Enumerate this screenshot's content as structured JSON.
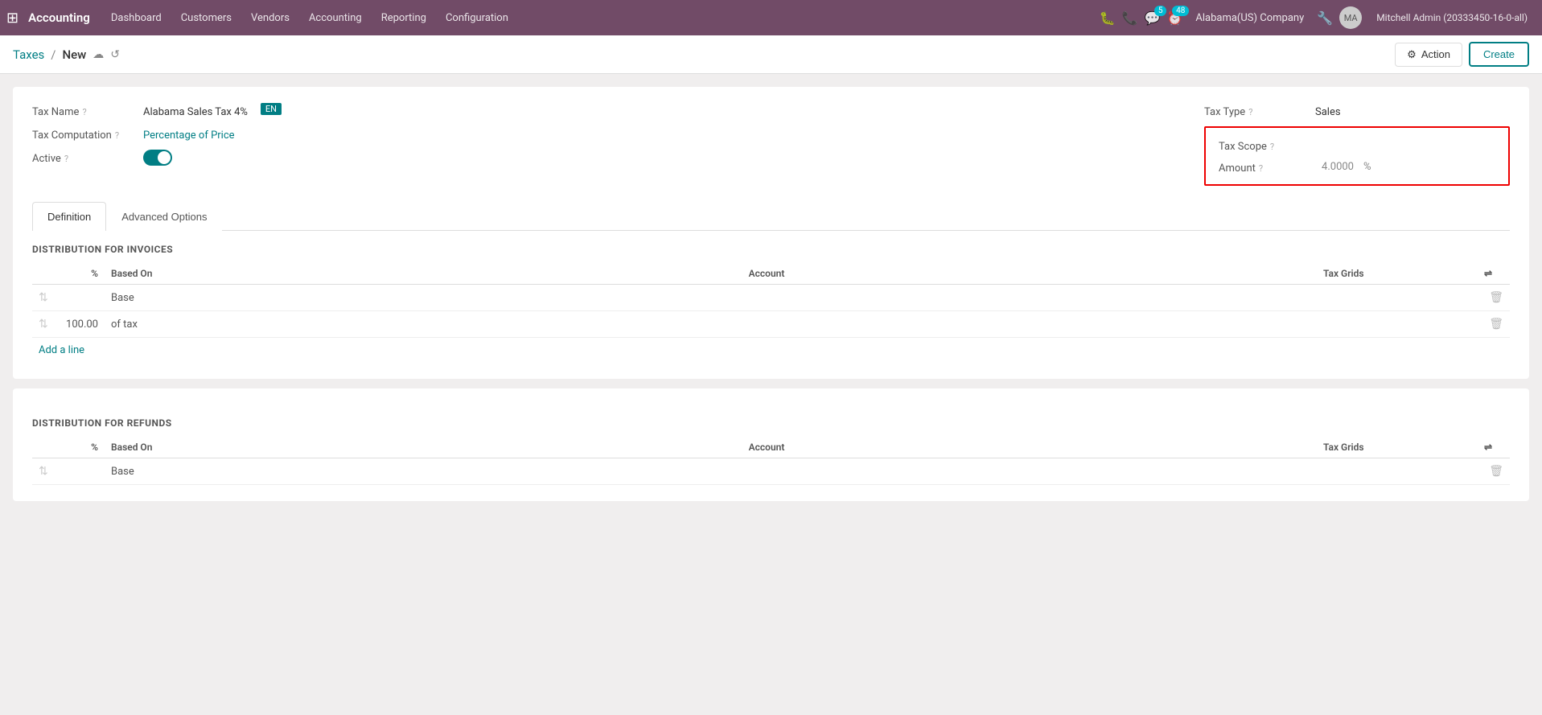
{
  "topnav": {
    "app_name": "Accounting",
    "nav_items": [
      "Dashboard",
      "Customers",
      "Vendors",
      "Accounting",
      "Reporting",
      "Configuration"
    ],
    "company": "Alabama(US) Company",
    "user": "Mitchell Admin (20333450-16-0-all)",
    "chat_badge": "5",
    "clock_badge": "48"
  },
  "breadcrumb": {
    "parent": "Taxes",
    "current": "New",
    "separator": "/"
  },
  "toolbar": {
    "action_label": "Action",
    "create_label": "Create"
  },
  "form": {
    "tax_name_label": "Tax Name",
    "tax_name_value": "Alabama Sales Tax 4%",
    "lang_badge": "EN",
    "tax_computation_label": "Tax Computation",
    "tax_computation_value": "Percentage of Price",
    "active_label": "Active",
    "tax_type_label": "Tax Type",
    "tax_type_value": "Sales",
    "tax_scope_label": "Tax Scope",
    "tax_scope_value": "",
    "amount_label": "Amount",
    "amount_value": "4.0000",
    "amount_unit": "%"
  },
  "tabs": [
    {
      "id": "definition",
      "label": "Definition",
      "active": true
    },
    {
      "id": "advanced_options",
      "label": "Advanced Options",
      "active": false
    }
  ],
  "invoices_section": {
    "title": "DISTRIBUTION FOR INVOICES",
    "columns": {
      "percent": "%",
      "based_on": "Based On",
      "account": "Account",
      "tax_grids": "Tax Grids"
    },
    "rows": [
      {
        "handle": true,
        "percent": "",
        "based_on": "Base",
        "account": "",
        "tax_grids": ""
      },
      {
        "handle": true,
        "percent": "100.00",
        "based_on": "of tax",
        "account": "",
        "tax_grids": ""
      }
    ],
    "add_line": "Add a line"
  },
  "refunds_section": {
    "title": "DISTRIBUTION FOR REFUNDS",
    "columns": {
      "percent": "%",
      "based_on": "Based On",
      "account": "Account",
      "tax_grids": "Tax Grids"
    },
    "rows": [
      {
        "handle": true,
        "percent": "",
        "based_on": "Base",
        "account": "",
        "tax_grids": ""
      }
    ]
  }
}
